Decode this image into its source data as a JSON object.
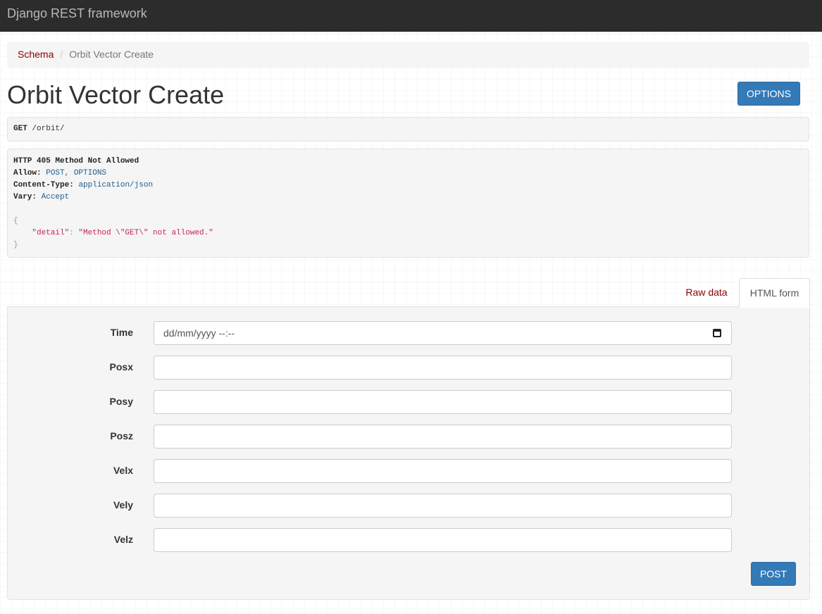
{
  "navbar": {
    "brand": "Django REST framework"
  },
  "breadcrumb": {
    "items": [
      "Schema",
      "Orbit Vector Create"
    ],
    "separator": "/"
  },
  "page": {
    "title": "Orbit Vector Create",
    "options_button": "OPTIONS"
  },
  "request": {
    "method": "GET",
    "path": "/orbit/"
  },
  "response": {
    "status": "HTTP 405 Method Not Allowed",
    "headers": [
      {
        "name": "Allow:",
        "value": "POST, OPTIONS"
      },
      {
        "name": "Content-Type:",
        "value": "application/json"
      },
      {
        "name": "Vary:",
        "value": "Accept"
      }
    ],
    "body": {
      "open": "{",
      "key": "\"detail\"",
      "colon": ": ",
      "value": "\"Method \\\"GET\\\" not allowed.\"",
      "close": "}"
    }
  },
  "tabs": {
    "raw": "Raw data",
    "html": "HTML form",
    "active": "HTML form"
  },
  "form": {
    "fields": [
      {
        "label": "Time",
        "type": "datetime",
        "placeholder": "dd/mm/yyyy --:--",
        "value": ""
      },
      {
        "label": "Posx",
        "value": ""
      },
      {
        "label": "Posy",
        "value": ""
      },
      {
        "label": "Posz",
        "value": ""
      },
      {
        "label": "Velx",
        "value": ""
      },
      {
        "label": "Vely",
        "value": ""
      },
      {
        "label": "Velz",
        "value": ""
      }
    ],
    "submit": "POST"
  },
  "colors": {
    "navbar": "#2c2c2c",
    "link": "#8b0000",
    "primary": "#337ab7",
    "well": "#f5f5f5"
  }
}
